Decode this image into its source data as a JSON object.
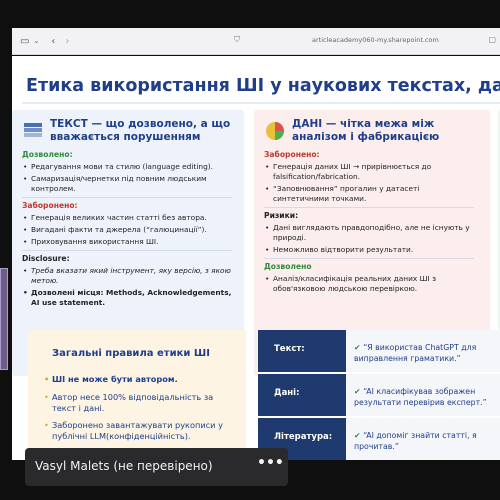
{
  "browser": {
    "url": "articleacademy060-my.sharepoint.com",
    "back_icon": "chevron-left-icon",
    "forward_icon": "chevron-right-icon",
    "sidebar_icon": "sidebar-toggle-icon",
    "dropdown_icon": "chevron-down-icon",
    "site_icon": "shield-icon"
  },
  "slide": {
    "title": "Етика використання ШІ у наукових текстах, даних і зобра",
    "text_card": {
      "title_line1": "ТЕКСТ — що дозволено, а що",
      "title_line2": "вважається порушенням",
      "allowed_label": "Дозволено:",
      "allowed": [
        "Редагування мови та стилю (language editing).",
        "Самаризація/чернетки під повним людським контролем."
      ],
      "forbidden_label": "Заборонено:",
      "forbidden": [
        "Генерація великих частин статті без автора.",
        "Вигадані факти та джерела (“галюцинації”).",
        "Приховування використання ШІ."
      ],
      "disclosure_label": "Disclosure:",
      "disclosure": [
        "Треба вказати який інструмент, яку версію, з якою метою.",
        "Дозволені місця: Methods, Acknowledgements, AI use statement."
      ]
    },
    "data_card": {
      "title_line1": "ДАНІ — чітка межа між",
      "title_line2": "аналізом і фабрикацією",
      "forbidden_label": "Заборонено:",
      "forbidden": [
        "Генерація даних ШІ → прирівнюється до falsification/fabrication.",
        "“Заповнювання” прогалин у датасеті синтетичними точками."
      ],
      "risks_label": "Ризики:",
      "risks": [
        "Дані виглядають правдоподібно, але не існують у природі.",
        "Неможливо відтворити результати."
      ],
      "allowed_label": "Дозволено",
      "allowed": [
        "Аналіз/класифікація реальних даних ШІ з обов'язковою людською перевіркою."
      ]
    },
    "rules": {
      "title": "Загальні правила етики ШІ",
      "items": [
        "ШІ не може бути автором.",
        "Автор несе 100% відповідальність за текст і дані.",
        "Заборонено завантажувати рукописи у публічні LLM(конфіденційність)."
      ]
    },
    "table": [
      {
        "key": "Текст:",
        "value": "“Я використав ChatGPT для виправлення граматики.”"
      },
      {
        "key": "Дані:",
        "value": "“AI класифікував зображен результати перевірив експерт.”"
      },
      {
        "key": "Література:",
        "value": "“AI допоміг знайти статті, я прочитав.”"
      }
    ]
  },
  "participant": {
    "name": "Vasyl Malets (не перевірено)",
    "more_icon": "more-options-icon"
  },
  "colors": {
    "title": "#1f3f8a",
    "green": "#2f8a3a",
    "red": "#c0392b",
    "table_key_bg": "#1f3a6e"
  }
}
